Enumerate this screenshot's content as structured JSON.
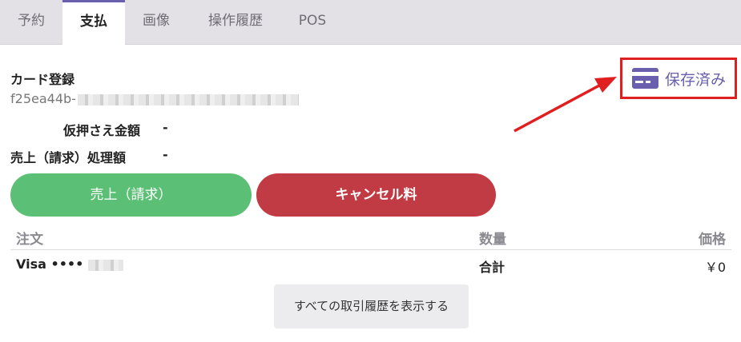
{
  "tabs": [
    {
      "label": "予約"
    },
    {
      "label": "支払"
    },
    {
      "label": "画像"
    },
    {
      "label": "操作履歴"
    },
    {
      "label": "POS"
    }
  ],
  "card": {
    "title": "カード登録",
    "id_prefix": "f25ea44b-"
  },
  "saved_button": {
    "label": "保存済み",
    "icon": "credit-card-icon",
    "color": "#6a5fae",
    "highlight_color": "#e02020"
  },
  "amounts": {
    "hold_label": "仮押さえ金額",
    "hold_value": "-",
    "sales_label": "売上（請求）処理額",
    "sales_value": "-"
  },
  "actions": {
    "charge_label": "売上（請求）",
    "charge_color": "#5bbf75",
    "cancel_label": "キャンセル料",
    "cancel_color": "#c13b44"
  },
  "table": {
    "headers": {
      "order": "注文",
      "quantity": "数量",
      "price": "価格"
    },
    "row": {
      "order": "Visa ••••",
      "quantity": "合計",
      "price": "￥0"
    }
  },
  "history_button": {
    "label": "すべての取引履歴を表示する"
  }
}
